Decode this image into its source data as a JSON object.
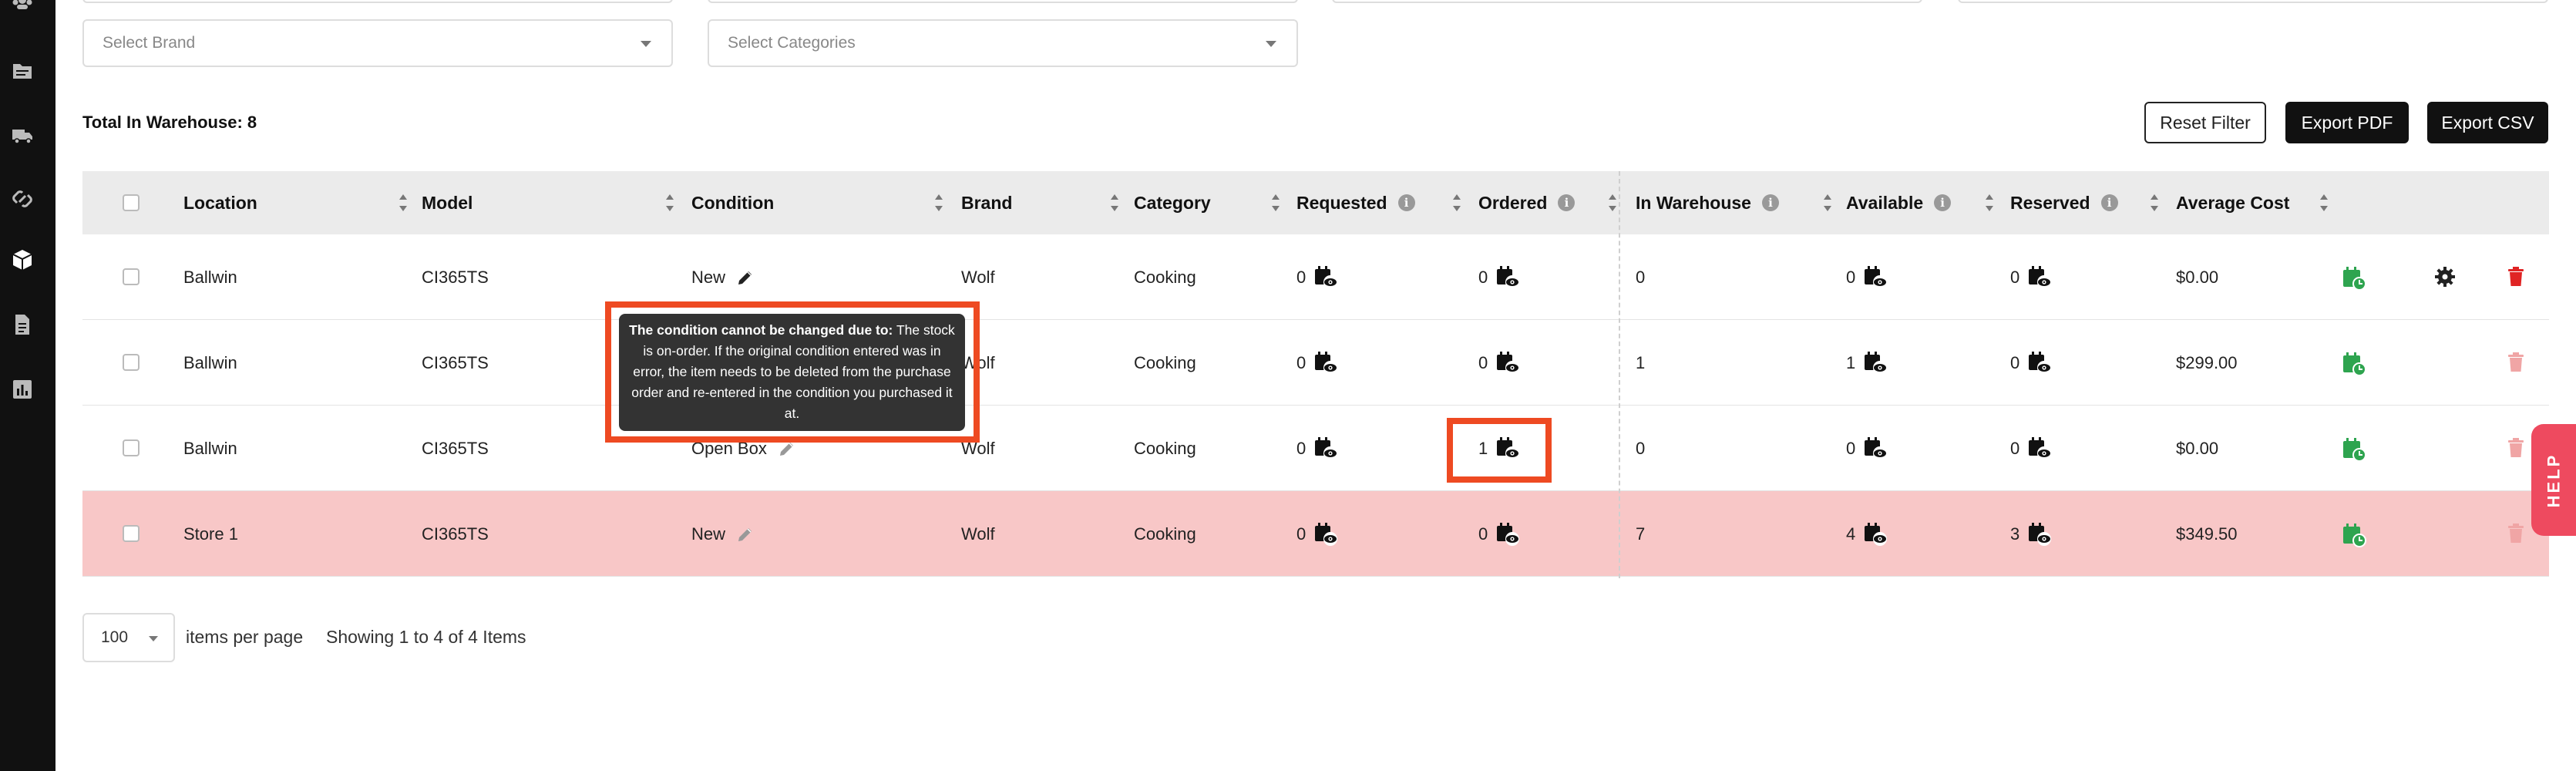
{
  "filters": {
    "brand_placeholder": "Select Brand",
    "categories_placeholder": "Select Categories"
  },
  "summary": {
    "total_label": "Total In Warehouse: 8"
  },
  "toolbar": {
    "reset_filter": "Reset Filter",
    "export_pdf": "Export PDF",
    "export_csv": "Export CSV"
  },
  "table": {
    "headers": {
      "location": "Location",
      "model": "Model",
      "condition": "Condition",
      "brand": "Brand",
      "category": "Category",
      "requested": "Requested",
      "ordered": "Ordered",
      "in_warehouse": "In Warehouse",
      "available": "Available",
      "reserved": "Reserved",
      "average_cost": "Average Cost"
    },
    "rows": [
      {
        "location": "Ballwin",
        "model": "CI365TS",
        "condition": "New",
        "brand": "Wolf",
        "category": "Cooking",
        "requested": "0",
        "ordered": "0",
        "in_warehouse": "0",
        "available": "0",
        "reserved": "0",
        "average_cost": "$0.00"
      },
      {
        "location": "Ballwin",
        "model": "CI365TS",
        "condition": "",
        "brand": "Wolf",
        "category": "Cooking",
        "requested": "0",
        "ordered": "0",
        "in_warehouse": "1",
        "available": "1",
        "reserved": "0",
        "average_cost": "$299.00"
      },
      {
        "location": "Ballwin",
        "model": "CI365TS",
        "condition": "Open Box",
        "brand": "Wolf",
        "category": "Cooking",
        "requested": "0",
        "ordered": "1",
        "in_warehouse": "0",
        "available": "0",
        "reserved": "0",
        "average_cost": "$0.00"
      },
      {
        "location": "Store 1",
        "model": "CI365TS",
        "condition": "New",
        "brand": "Wolf",
        "category": "Cooking",
        "requested": "0",
        "ordered": "0",
        "in_warehouse": "7",
        "available": "4",
        "reserved": "3",
        "average_cost": "$349.50"
      }
    ]
  },
  "tooltip": {
    "bold": "The condition cannot be changed due to:",
    "text": "The stock is on-order. If the original condition entered was in error, the item needs to be deleted from the purchase order and re-entered in the condition you purchased it at."
  },
  "pagination": {
    "per_page": "100",
    "per_page_label": "items per page",
    "showing": "Showing 1 to 4 of 4 Items"
  },
  "help_label": "HELP",
  "colors": {
    "highlight": "#ee4a22",
    "row_highlight": "#f8c7c7",
    "green_action": "#2ea44f",
    "delete_red": "#e02424",
    "help_tab": "#ee4a5f"
  },
  "icons": [
    "users-icon",
    "folder-icon",
    "truck-icon",
    "link-icon",
    "box-icon",
    "document-icon",
    "chart-icon",
    "eye-calendar-icon",
    "pencil-icon",
    "calendar-clock-icon",
    "gear-icon",
    "trash-icon"
  ]
}
